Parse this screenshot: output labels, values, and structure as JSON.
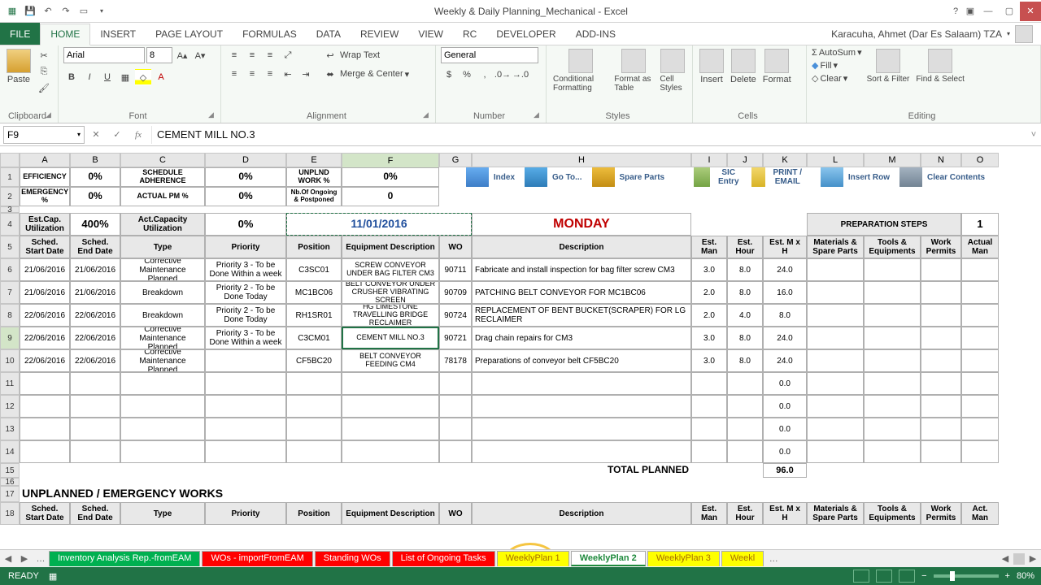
{
  "titlebar": {
    "title": "Weekly & Daily Planning_Mechanical - Excel"
  },
  "account": "Karacuha, Ahmet (Dar Es Salaam) TZA",
  "tabs": {
    "file": "FILE",
    "home": "HOME",
    "insert": "INSERT",
    "page": "PAGE LAYOUT",
    "formulas": "FORMULAS",
    "data": "DATA",
    "review": "REVIEW",
    "view": "VIEW",
    "rc": "RC",
    "dev": "DEVELOPER",
    "addins": "ADD-INS"
  },
  "ribbon": {
    "clipboard": "Clipboard",
    "paste": "Paste",
    "font": "Font",
    "fontName": "Arial",
    "fontSize": "8",
    "alignment": "Alignment",
    "wrap": "Wrap Text",
    "merge": "Merge & Center",
    "number": "Number",
    "numFormat": "General",
    "styles": "Styles",
    "cond": "Conditional Formatting",
    "ftable": "Format as Table",
    "cstyles": "Cell Styles",
    "cells": "Cells",
    "insert": "Insert",
    "delete": "Delete",
    "format": "Format",
    "editing": "Editing",
    "autosum": "AutoSum",
    "fill": "Fill",
    "clear": "Clear",
    "sort": "Sort & Filter",
    "find": "Find & Select"
  },
  "namebox": "F9",
  "formula": "CEMENT MILL NO.3",
  "cols": [
    "A",
    "B",
    "C",
    "D",
    "E",
    "F",
    "G",
    "H",
    "I",
    "J",
    "K",
    "L",
    "M",
    "N",
    "O"
  ],
  "kpi": {
    "eff": "EFFICIENCY",
    "effv": "0%",
    "sch": "SCHEDULE ADHERENCE",
    "schv": "0%",
    "unp": "UNPLND WORK %",
    "unpv": "0%",
    "emg": "EMERGENCY %",
    "emgv": "0%",
    "apm": "ACTUAL PM %",
    "apmv": "0%",
    "nbo": "Nb.Of Ongoing & Postponed",
    "nbov": "0"
  },
  "qbtns": {
    "index": "Index",
    "goto": "Go To...",
    "spare": "Spare Parts",
    "sic": "SIC Entry",
    "print": "PRINT / EMAIL",
    "irow": "Insert Row",
    "clr": "Clear Contents"
  },
  "summary": {
    "estcap": "Est.Cap. Utilization",
    "estcapv": "400%",
    "actcap": "Act.Capacity Utilization",
    "actcapv": "0%",
    "date": "11/01/2016",
    "day": "MONDAY",
    "prep": "PREPARATION STEPS",
    "step": "1"
  },
  "hdrs": {
    "ss": "Sched. Start Date",
    "se": "Sched. End Date",
    "type": "Type",
    "prio": "Priority",
    "pos": "Position",
    "eq": "Equipment Description",
    "wo": "WO",
    "desc": "Description",
    "eman": "Est. Man",
    "ehour": "Est. Hour",
    "emxh": "Est. M x H",
    "mat": "Materials & Spare Parts",
    "tools": "Tools & Equipments",
    "wp": "Work Permits",
    "aman": "Actual Man"
  },
  "rows": [
    {
      "ss": "21/06/2016",
      "se": "21/06/2016",
      "type": "Corrective Maintenance Planned",
      "prio": "Priority 3 - To be Done Within a week",
      "pos": "C3SC01",
      "eq": "SCREW CONVEYOR UNDER BAG FILTER CM3",
      "wo": "90711",
      "desc": "Fabricate and install inspection for bag filter screw CM3",
      "eman": "3.0",
      "ehour": "8.0",
      "emxh": "24.0"
    },
    {
      "ss": "21/06/2016",
      "se": "21/06/2016",
      "type": "Breakdown",
      "prio": "Priority 2 - To be Done Today",
      "pos": "MC1BC06",
      "eq": "BELT CONVEYOR UNDER CRUSHER VIBRATING SCREEN",
      "wo": "90709",
      "desc": "PATCHING BELT CONVEYOR FOR MC1BC06",
      "eman": "2.0",
      "ehour": "8.0",
      "emxh": "16.0"
    },
    {
      "ss": "22/06/2016",
      "se": "22/06/2016",
      "type": "Breakdown",
      "prio": "Priority 2 - To be Done Today",
      "pos": "RH1SR01",
      "eq": "HG LIMESTONE TRAVELLING BRIDGE RECLAIMER",
      "wo": "90724",
      "desc": "REPLACEMENT OF BENT BUCKET(SCRAPER) FOR LG RECLAIMER",
      "eman": "2.0",
      "ehour": "4.0",
      "emxh": "8.0"
    },
    {
      "ss": "22/06/2016",
      "se": "22/06/2016",
      "type": "Corrective Maintenance Planned",
      "prio": "Priority 3 - To be Done Within a week",
      "pos": "C3CM01",
      "eq": "CEMENT MILL NO.3",
      "wo": "90721",
      "desc": "Drag chain repairs for CM3",
      "eman": "3.0",
      "ehour": "8.0",
      "emxh": "24.0"
    },
    {
      "ss": "22/06/2016",
      "se": "22/06/2016",
      "type": "Corrective Maintenance Planned",
      "prio": "",
      "pos": "CF5BC20",
      "eq": "BELT CONVEYOR FEEDING CM4",
      "wo": "78178",
      "desc": "Preparations of conveyor belt  CF5BC20",
      "eman": "3.0",
      "ehour": "8.0",
      "emxh": "24.0"
    }
  ],
  "blank_mxh": [
    "0.0",
    "0.0",
    "0.0",
    "0.0"
  ],
  "total": {
    "label": "TOTAL PLANNED",
    "value": "96.0"
  },
  "unplanned": "UNPLANNED / EMERGENCY WORKS",
  "hdrs2": {
    "aman": "Act. Man"
  },
  "sheettabs": [
    {
      "label": "Inventory Analysis Rep.-fromEAM",
      "cls": "green"
    },
    {
      "label": "WOs - importFromEAM",
      "cls": "red"
    },
    {
      "label": "Standing WOs",
      "cls": "red"
    },
    {
      "label": "List of Ongoing Tasks",
      "cls": "red"
    },
    {
      "label": "WeeklyPlan 1",
      "cls": "yellow"
    },
    {
      "label": "WeeklyPlan 2",
      "cls": "active"
    },
    {
      "label": "WeeklyPlan 3",
      "cls": "yellow"
    },
    {
      "label": "Weekl",
      "cls": "yellow"
    }
  ],
  "status": {
    "ready": "READY",
    "zoom": "80%"
  }
}
